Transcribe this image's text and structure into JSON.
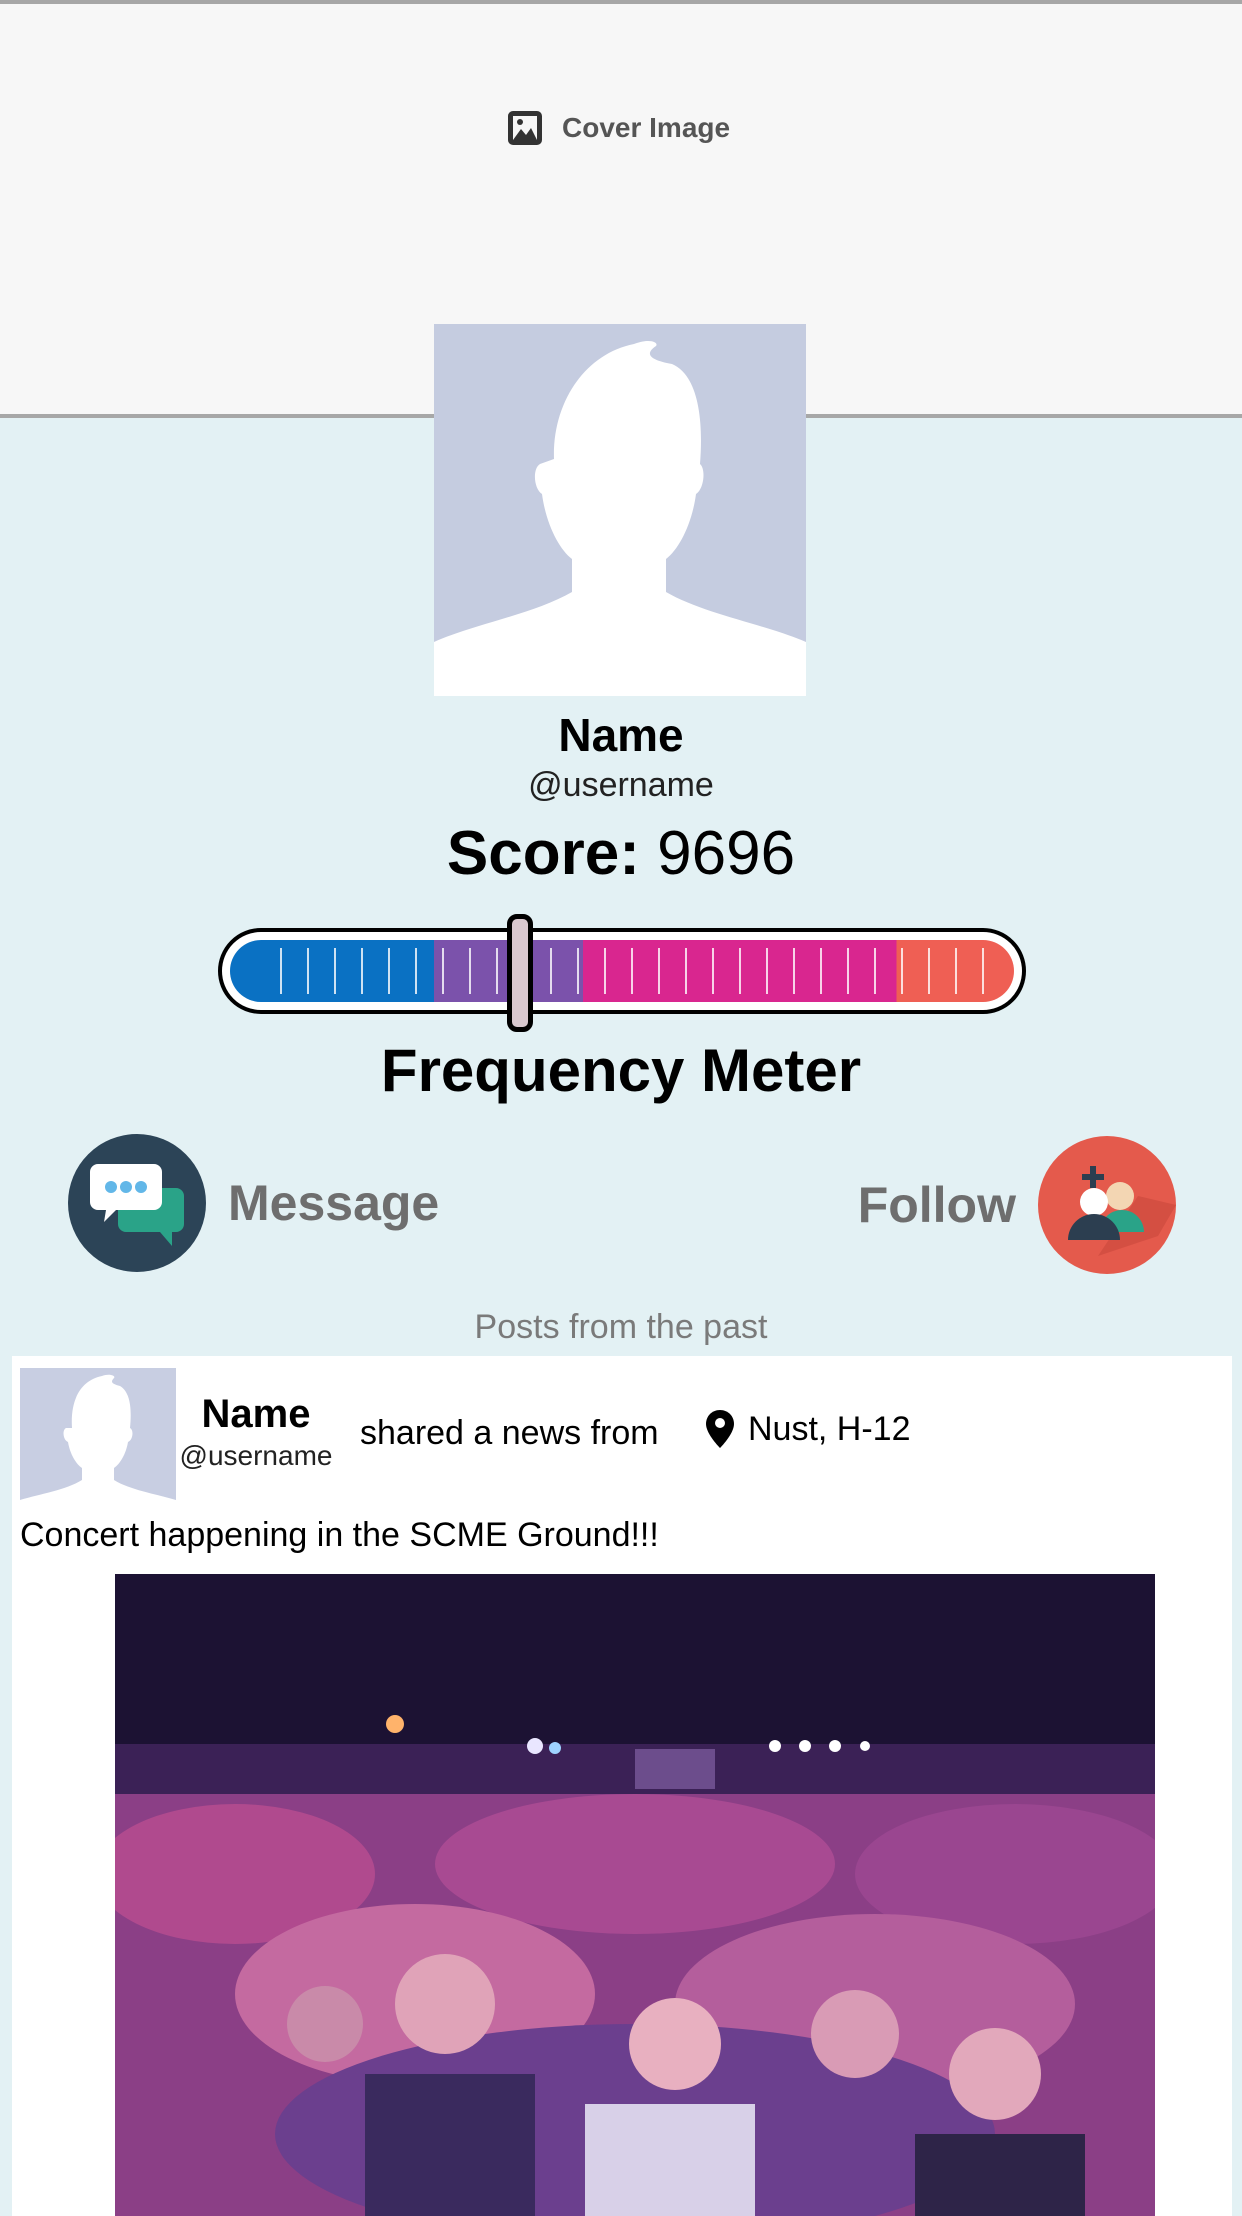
{
  "cover": {
    "label": "Cover Image",
    "icon": "image-icon"
  },
  "profile": {
    "name": "Name",
    "username": "@username",
    "score_label": "Score:",
    "score_value": "9696"
  },
  "meter": {
    "title": "Frequency Meter",
    "level": 0.37,
    "segments": [
      {
        "color": "#0a71c3"
      },
      {
        "color": "#7b52ab"
      },
      {
        "color": "#d9268f"
      },
      {
        "color": "#ef5f54"
      }
    ]
  },
  "actions": {
    "message": {
      "label": "Message",
      "icon": "chat-bubbles-icon",
      "color": "#2c4457"
    },
    "follow": {
      "label": "Follow",
      "icon": "add-user-icon",
      "color": "#e45a4c"
    }
  },
  "posts": {
    "heading": "Posts from the past",
    "items": [
      {
        "name": "Name",
        "username": "@username",
        "action_text": "shared a news from",
        "location_icon": "map-pin-icon",
        "location": "Nust, H-12",
        "text": "Concert happening in the SCME Ground!!!",
        "image_icon": "concert-crowd-photo"
      }
    ]
  }
}
